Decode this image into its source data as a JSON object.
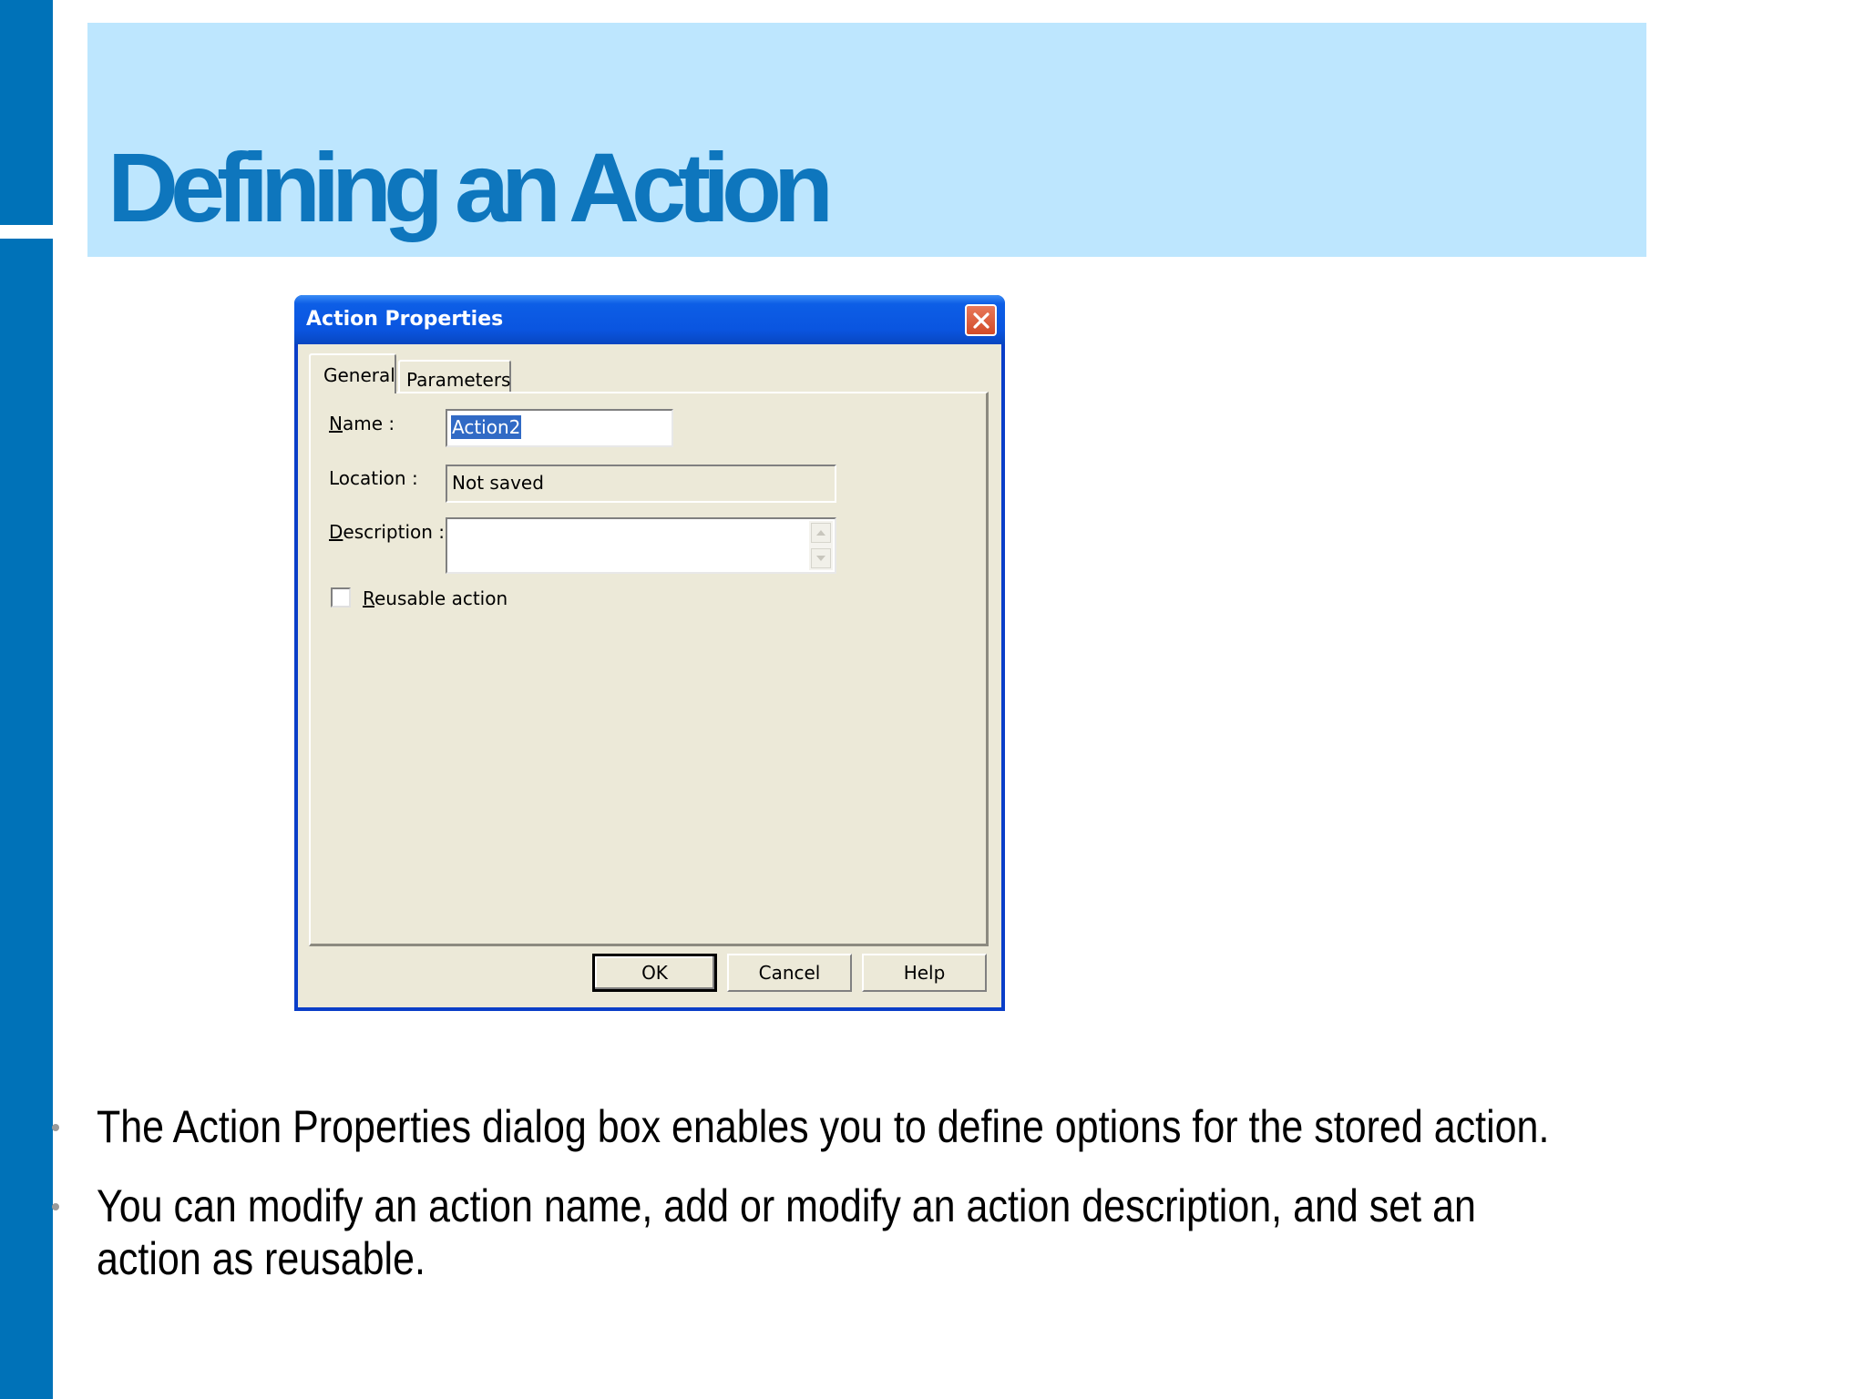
{
  "slide": {
    "title": "Defining an Action",
    "bullets": [
      "The Action Properties dialog box enables you to define options for the stored action.",
      "You can modify an action name, add or modify an action description, and set an action as reusable."
    ]
  },
  "dialog": {
    "title": "Action Properties",
    "close_icon": "close-icon",
    "tabs": [
      {
        "label": "General",
        "active": true
      },
      {
        "label": "Parameters",
        "active": false
      }
    ],
    "fields": {
      "name_label_accel": "N",
      "name_label_rest": "ame :",
      "name_value": "Action2",
      "location_label": "Location :",
      "location_value": "Not saved",
      "description_label_accel": "D",
      "description_label_rest": "escription :",
      "description_value": ""
    },
    "checkbox": {
      "label_accel": "R",
      "label_rest": "eusable action",
      "checked": false
    },
    "buttons": {
      "ok": "OK",
      "cancel": "Cancel",
      "help": "Help"
    }
  },
  "colors": {
    "accent_blue": "#0072b8",
    "title_band": "#bde6fe",
    "title_text": "#0e76bd",
    "dialog_face": "#ece9d8",
    "titlebar_blue": "#0a55e0",
    "selection": "#316ac5"
  }
}
